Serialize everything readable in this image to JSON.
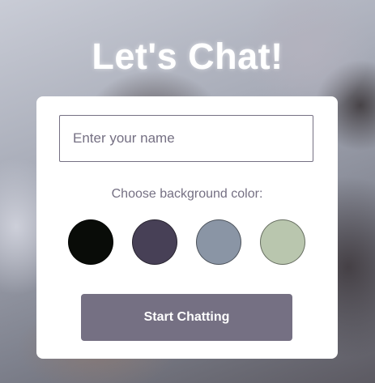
{
  "header": {
    "title": "Let's Chat!"
  },
  "form": {
    "name_placeholder": "Enter your name",
    "name_value": "",
    "color_label": "Choose background color:",
    "colors": [
      "#090C08",
      "#474056",
      "#8A95A5",
      "#B9C6AE"
    ],
    "button_label": "Start Chatting",
    "button_color": "#757083"
  }
}
